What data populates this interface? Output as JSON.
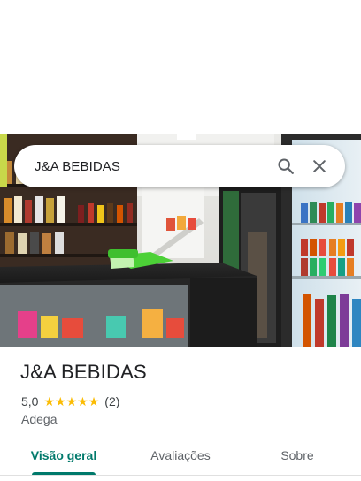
{
  "search": {
    "query": "J&A BEBIDAS",
    "search_icon": "search-icon",
    "clear_icon": "close-icon"
  },
  "place": {
    "name": "J&A BEBIDAS",
    "rating": "5,0",
    "rating_value": 5.0,
    "stars_filled": 5,
    "review_count": "(2)",
    "category": "Adega"
  },
  "photo": {
    "description_icon": "store-photo"
  },
  "tabs": [
    {
      "label": "Visão geral",
      "active": true
    },
    {
      "label": "Avaliações",
      "active": false
    },
    {
      "label": "Sobre",
      "active": false
    }
  ],
  "colors": {
    "accent": "#00796b",
    "star": "#fbbc04",
    "text": "#202124",
    "secondary": "#5f6368"
  }
}
